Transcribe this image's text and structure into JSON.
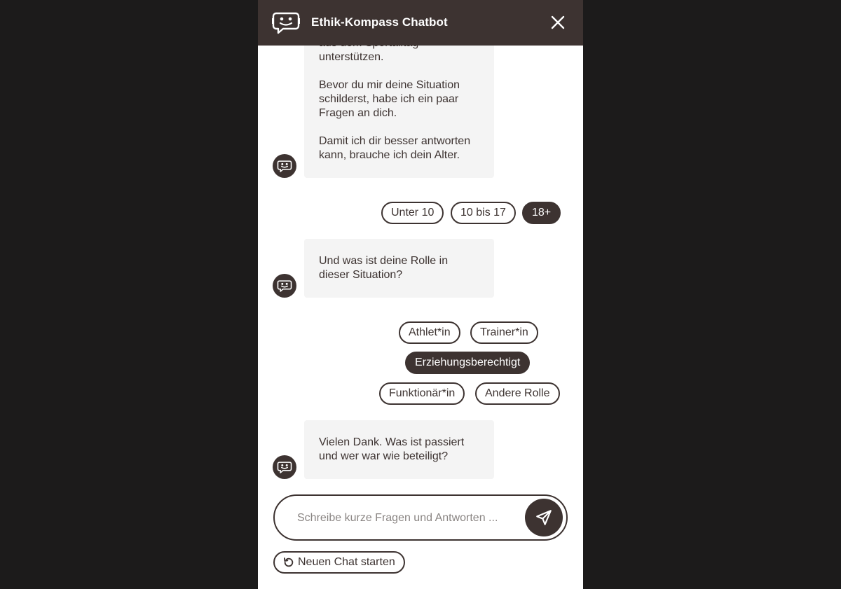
{
  "header": {
    "title": "Ethik-Kompass Chatbot",
    "logo_icon": "chatbot-icon",
    "close_icon": "close-icon"
  },
  "messages": [
    {
      "sender": "bot",
      "paragraphs": [
        "aus dem Sportalltag unterstützen.",
        "Bevor du mir deine Situation schilderst, habe ich ein paar Fragen an dich.",
        "Damit ich dir besser antworten kann, brauche ich dein Alter."
      ]
    },
    {
      "sender": "bot",
      "paragraphs": [
        "Und was ist deine Rolle in dieser Situation?"
      ]
    },
    {
      "sender": "bot",
      "paragraphs": [
        "Vielen Dank. Was ist passiert und wer war wie beteiligt?"
      ]
    }
  ],
  "age_options": [
    {
      "label": "Unter 10",
      "selected": false
    },
    {
      "label": "10 bis 17",
      "selected": false
    },
    {
      "label": "18+",
      "selected": true
    }
  ],
  "role_options": [
    {
      "label": "Athlet*in",
      "selected": false
    },
    {
      "label": "Trainer*in",
      "selected": false
    },
    {
      "label": "Erziehungsberechtigt",
      "selected": true
    },
    {
      "label": "Funktionär*in",
      "selected": false
    },
    {
      "label": "Andere Rolle",
      "selected": false
    }
  ],
  "composer": {
    "placeholder": "Schreibe kurze Fragen und Antworten ...",
    "value": "",
    "send_icon": "send-icon"
  },
  "new_chat": {
    "label": "Neuen Chat starten",
    "icon": "restart-icon"
  },
  "colors": {
    "brand_dark": "#3d3331",
    "bubble_bg": "#f4f4f4",
    "page_bg": "#1c1b1b"
  }
}
